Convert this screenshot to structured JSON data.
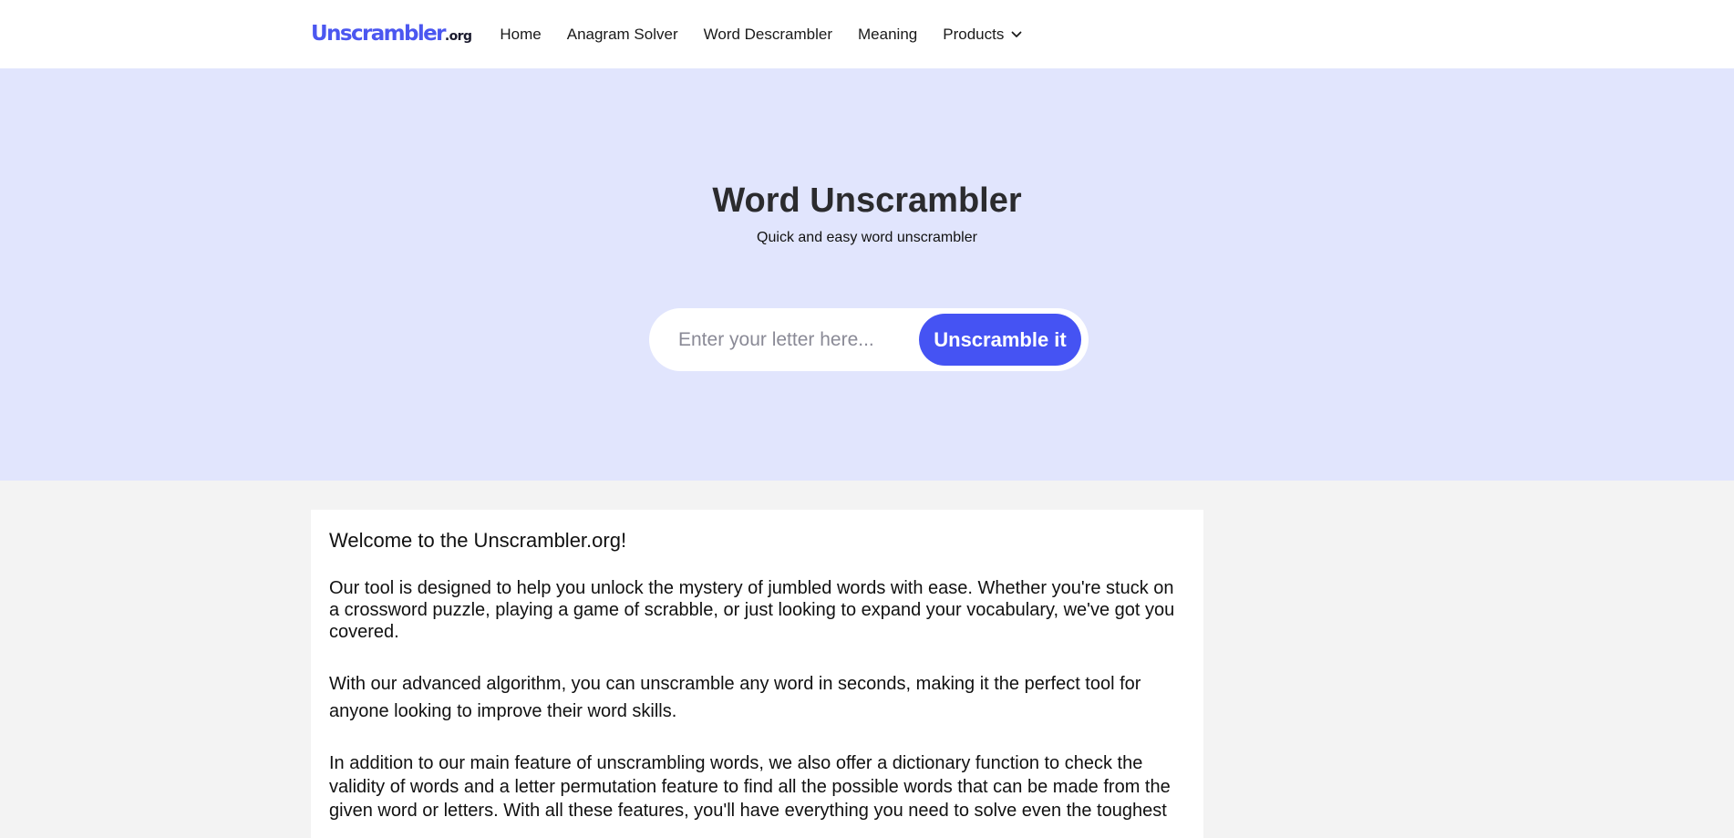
{
  "header": {
    "logo_main": "Unscrambler",
    "logo_tld": ".org",
    "nav": [
      {
        "label": "Home"
      },
      {
        "label": "Anagram Solver"
      },
      {
        "label": "Word Descrambler"
      },
      {
        "label": "Meaning"
      },
      {
        "label": "Products"
      }
    ],
    "products_icon": "chevron-down-icon"
  },
  "hero": {
    "title": "Word Unscrambler",
    "subtitle": "Quick and easy word unscrambler",
    "search": {
      "placeholder": "Enter your letter here...",
      "value": "",
      "button_label": "Unscramble it"
    }
  },
  "content": {
    "welcome": "Welcome to the Unscrambler.org!",
    "paragraphs": [
      "Our tool is designed to help you unlock the mystery of jumbled words with ease. Whether you're stuck on a crossword puzzle, playing a game of scrabble, or just looking to expand your vocabulary, we've got you covered.",
      "With our advanced algorithm, you can unscramble any word in seconds, making it the perfect tool for anyone looking to improve their word skills.",
      "In addition to our main feature of unscrambling words, we also offer a dictionary function to check the validity of words and a letter permutation feature to find all the possible words that can be made from the given word or letters. With all these features, you'll have everything you need to solve even the toughest"
    ]
  },
  "colors": {
    "brand": "#4b57f0",
    "button": "#4553f3",
    "hero_bg": "#e1e5fd",
    "page_bg": "#f3f3f3"
  }
}
